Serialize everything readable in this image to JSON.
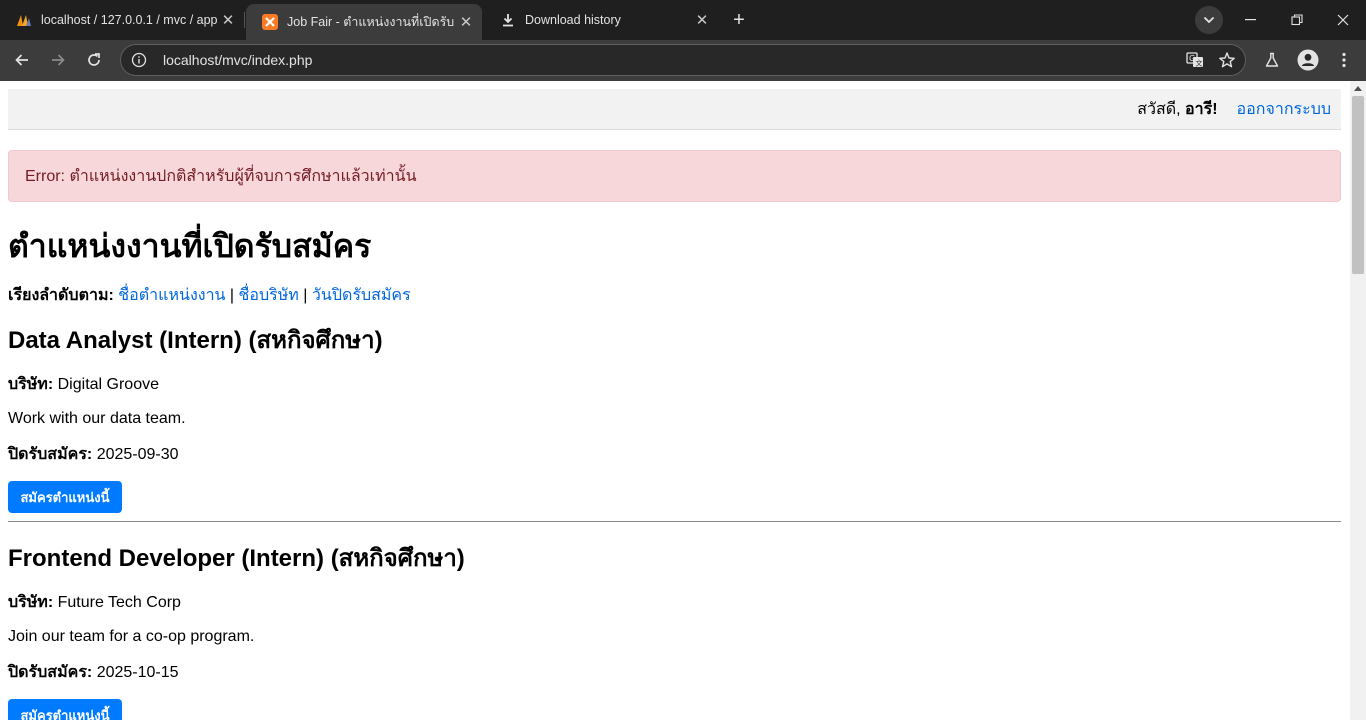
{
  "browser": {
    "tabs": [
      {
        "title": "localhost / 127.0.0.1 / mvc / app",
        "icon": "phpmyadmin-icon"
      },
      {
        "title": "Job Fair - ตำแหน่งงานที่เปิดรับ",
        "icon": "xampp-icon",
        "active": true
      },
      {
        "title": "Download history",
        "icon": "download-icon"
      }
    ],
    "url": "localhost/mvc/index.php"
  },
  "header": {
    "greeting_prefix": "สวัสดี, ",
    "user_name": "อารี!",
    "logout_label": "ออกจากระบบ"
  },
  "alert": {
    "message": "Error: ตำแหน่งงานปกติสำหรับผู้ที่จบการศึกษาแล้วเท่านั้น"
  },
  "page": {
    "title": "ตำแหน่งงานที่เปิดรับสมัคร",
    "sort_label": "เรียงลำดับตาม:",
    "sort_options": [
      "ชื่อตำแหน่งงาน",
      "ชื่อบริษัท",
      "วันปิดรับสมัคร"
    ],
    "sort_separator": " | "
  },
  "jobs": [
    {
      "title": "Data Analyst (Intern) (สหกิจศึกษา)",
      "company_label": "บริษัท:",
      "company": "Digital Groove",
      "description": "Work with our data team.",
      "deadline_label": "ปิดรับสมัคร:",
      "deadline": "2025-09-30",
      "apply_label": "สมัครตำแหน่งนี้"
    },
    {
      "title": "Frontend Developer (Intern) (สหกิจศึกษา)",
      "company_label": "บริษัท:",
      "company": "Future Tech Corp",
      "description": "Join our team for a co-op program.",
      "deadline_label": "ปิดรับสมัคร:",
      "deadline": "2025-10-15",
      "apply_label": "สมัครตำแหน่งนี้"
    }
  ],
  "colors": {
    "link": "#0066dd",
    "alert_bg": "#f8d7da",
    "alert_text": "#721c24",
    "button_bg": "#007bff"
  }
}
